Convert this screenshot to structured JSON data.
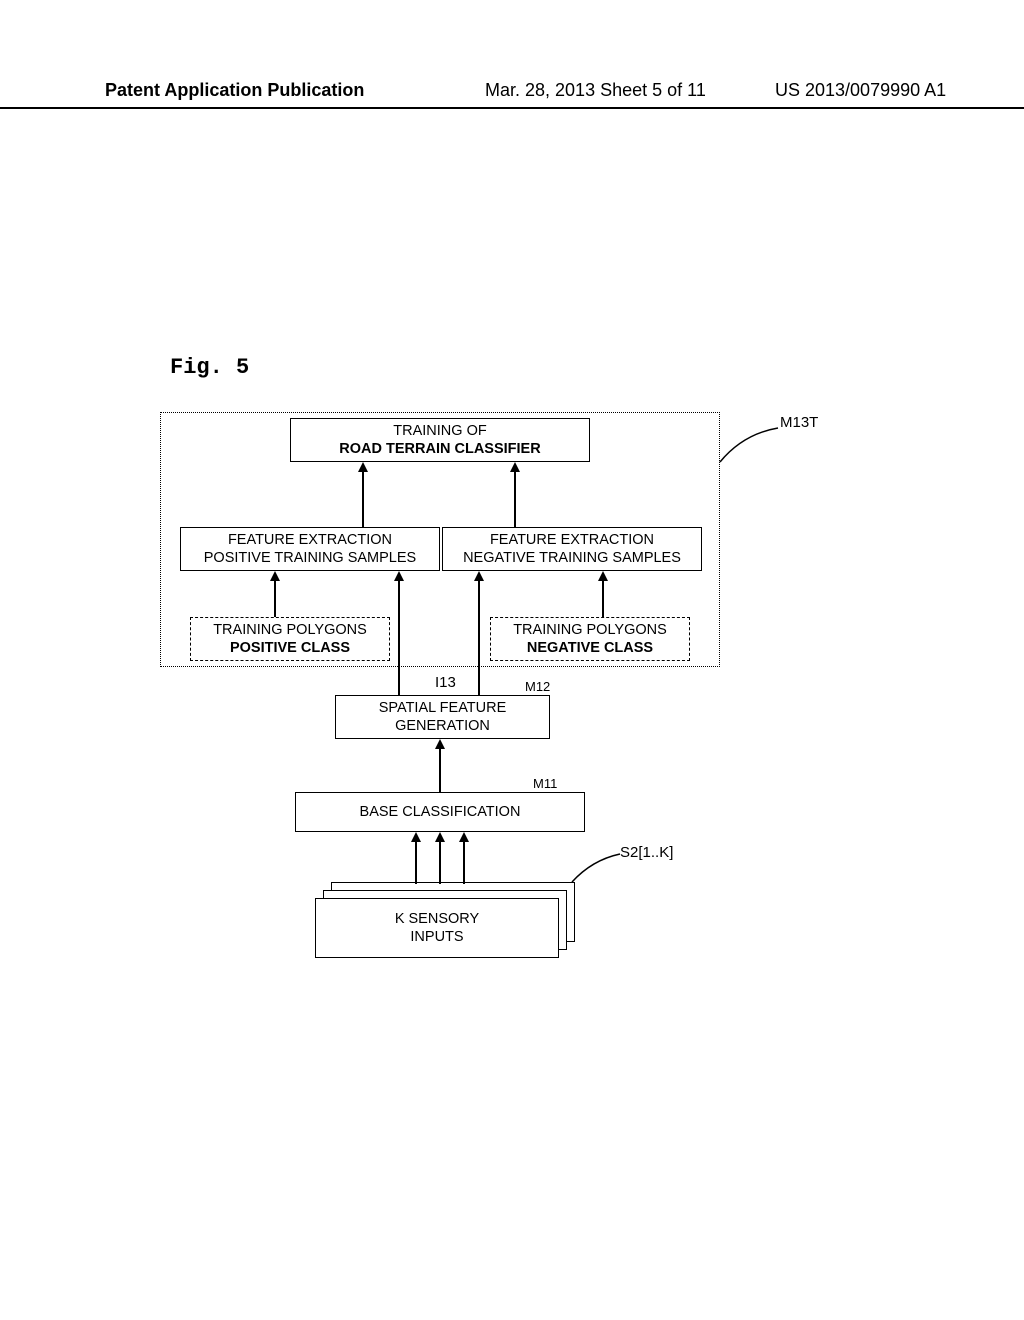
{
  "header": {
    "left": "Patent Application Publication",
    "mid": "Mar. 28, 2013  Sheet 5 of 11",
    "right": "US 2013/0079990 A1"
  },
  "figure_label": "Fig. 5",
  "boxes": {
    "training_of": "TRAINING OF",
    "road_terrain": "ROAD TERRAIN CLASSIFIER",
    "feat_pos_l1": "FEATURE EXTRACTION",
    "feat_pos_l2": "POSITIVE TRAINING SAMPLES",
    "feat_neg_l1": "FEATURE EXTRACTION",
    "feat_neg_l2": "NEGATIVE TRAINING SAMPLES",
    "poly_pos_l1": "TRAINING POLYGONS",
    "poly_pos_l2": "POSITIVE CLASS",
    "poly_neg_l1": "TRAINING POLYGONS",
    "poly_neg_l2": "NEGATIVE CLASS",
    "spatial_l1": "SPATIAL FEATURE",
    "spatial_l2": "GENERATION",
    "base_class": "BASE CLASSIFICATION",
    "k_sensory_l1": "K SENSORY",
    "k_sensory_l2": "INPUTS"
  },
  "labels": {
    "m13t": "M13T",
    "i13": "I13",
    "m12": "M12",
    "m11": "M11",
    "s2": "S2[1..K]"
  }
}
